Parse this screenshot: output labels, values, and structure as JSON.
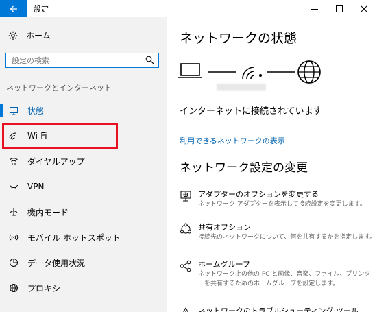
{
  "window": {
    "title": "設定"
  },
  "sidebar": {
    "home_label": "ホーム",
    "search_placeholder": "設定の検索",
    "section_label": "ネットワークとインターネット",
    "items": [
      {
        "label": "状態",
        "icon": "status-icon",
        "selected": true
      },
      {
        "label": "Wi-Fi",
        "icon": "wifi-icon"
      },
      {
        "label": "ダイヤルアップ",
        "icon": "dialup-icon"
      },
      {
        "label": "VPN",
        "icon": "vpn-icon"
      },
      {
        "label": "機内モード",
        "icon": "airplane-icon"
      },
      {
        "label": "モバイル ホットスポット",
        "icon": "hotspot-icon"
      },
      {
        "label": "データ使用状況",
        "icon": "data-usage-icon"
      },
      {
        "label": "プロキシ",
        "icon": "proxy-icon"
      }
    ]
  },
  "main": {
    "status_heading": "ネットワークの状態",
    "connection_status": "インターネットに接続されています",
    "available_networks_link": "利用できるネットワークの表示",
    "change_heading": "ネットワーク設定の変更",
    "settings": [
      {
        "title": "アダプターのオプションを変更する",
        "description": "ネットワーク アダプターを表示して接続設定を変更します。",
        "icon": "adapter-icon"
      },
      {
        "title": "共有オプション",
        "description": "接続先のネットワークについて、何を共有するかを指定します。",
        "icon": "sharing-icon"
      },
      {
        "title": "ホームグループ",
        "description": "ネットワーク上の他の PC と画像、音楽、ファイル、プリンターを共有するためのホームグループを設定します。",
        "icon": "homegroup-icon"
      },
      {
        "title": "ネットワークのトラブルシューティング ツール",
        "description": "",
        "icon": "troubleshoot-icon"
      }
    ]
  },
  "colors": {
    "accent": "#0078d7",
    "link": "#0063b1",
    "highlight": "#e81123",
    "sidebar_bg": "#f2f2f2"
  }
}
